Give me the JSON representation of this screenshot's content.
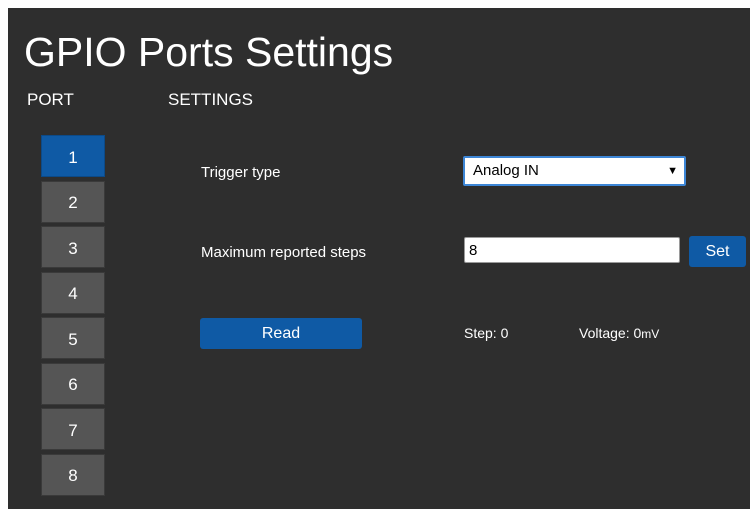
{
  "header": {
    "title": "GPIO Ports Settings"
  },
  "columns": {
    "port": "PORT",
    "settings": "SETTINGS"
  },
  "ports": [
    {
      "label": "1",
      "active": true
    },
    {
      "label": "2",
      "active": false
    },
    {
      "label": "3",
      "active": false
    },
    {
      "label": "4",
      "active": false
    },
    {
      "label": "5",
      "active": false
    },
    {
      "label": "6",
      "active": false
    },
    {
      "label": "7",
      "active": false
    },
    {
      "label": "8",
      "active": false
    }
  ],
  "settings": {
    "trigger_label": "Trigger type",
    "trigger_value": "Analog IN",
    "trigger_arrow": "▼",
    "steps_label": "Maximum reported steps",
    "steps_value": "8",
    "set_label": "Set",
    "read_label": "Read",
    "step_label": "Step:",
    "step_value": "0",
    "voltage_label": "Voltage:",
    "voltage_value": "0",
    "voltage_unit": "mV"
  },
  "colors": {
    "background": "#2e2e2e",
    "accent": "#0f5aa5",
    "port_inactive": "#555555"
  }
}
